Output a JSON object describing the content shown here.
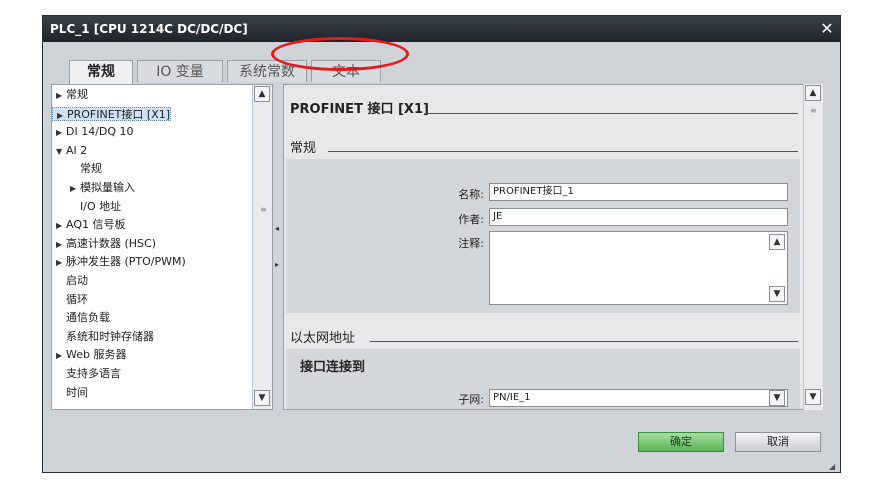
{
  "window": {
    "title": "PLC_1 [CPU 1214C DC/DC/DC]",
    "close_glyph": "✕"
  },
  "tabs": [
    {
      "label": "常规",
      "active": true
    },
    {
      "label": "IO 变量",
      "active": false
    },
    {
      "label": "系统常数",
      "active": false
    },
    {
      "label": "文本",
      "active": false
    }
  ],
  "annotation": {
    "color": "#e8191c",
    "target": "文本"
  },
  "tree": {
    "items": [
      {
        "label": "常规",
        "arrow": "▶",
        "indent": 0
      },
      {
        "label": "PROFINET接口 [X1]",
        "arrow": "▶",
        "indent": 0,
        "selected": true
      },
      {
        "label": "DI 14/DQ 10",
        "arrow": "▶",
        "indent": 0
      },
      {
        "label": "AI 2",
        "arrow": "▼",
        "indent": 0
      },
      {
        "label": "常规",
        "arrow": "",
        "indent": 1
      },
      {
        "label": "模拟量输入",
        "arrow": "▶",
        "indent": 1
      },
      {
        "label": "I/O 地址",
        "arrow": "",
        "indent": 1
      },
      {
        "label": "AQ1 信号板",
        "arrow": "▶",
        "indent": 0
      },
      {
        "label": "高速计数器 (HSC)",
        "arrow": "▶",
        "indent": 0
      },
      {
        "label": "脉冲发生器 (PTO/PWM)",
        "arrow": "▶",
        "indent": 0
      },
      {
        "label": "启动",
        "arrow": "",
        "indent": 0
      },
      {
        "label": "循环",
        "arrow": "",
        "indent": 0
      },
      {
        "label": "通信负载",
        "arrow": "",
        "indent": 0
      },
      {
        "label": "系统和时钟存储器",
        "arrow": "",
        "indent": 0
      },
      {
        "label": "Web 服务器",
        "arrow": "▶",
        "indent": 0
      },
      {
        "label": "支持多语言",
        "arrow": "",
        "indent": 0
      },
      {
        "label": "时间",
        "arrow": "",
        "indent": 0
      }
    ]
  },
  "content": {
    "heading": "PROFINET 接口 [X1]",
    "general_section": "常规",
    "fields": {
      "name_label": "名称:",
      "name_value": "PROFINET接口_1",
      "author_label": "作者:",
      "author_value": "JE",
      "comment_label": "注释:",
      "comment_value": ""
    },
    "ethernet_section": "以太网地址",
    "interface_connected": "接口连接到",
    "subnet_label": "子网:",
    "subnet_value": "PN/IE_1"
  },
  "buttons": {
    "ok": "确定",
    "cancel": "取消"
  },
  "colors": {
    "ok_green": "#57b453",
    "titlebar": "#20242b",
    "selection": "#cfe3f5"
  }
}
